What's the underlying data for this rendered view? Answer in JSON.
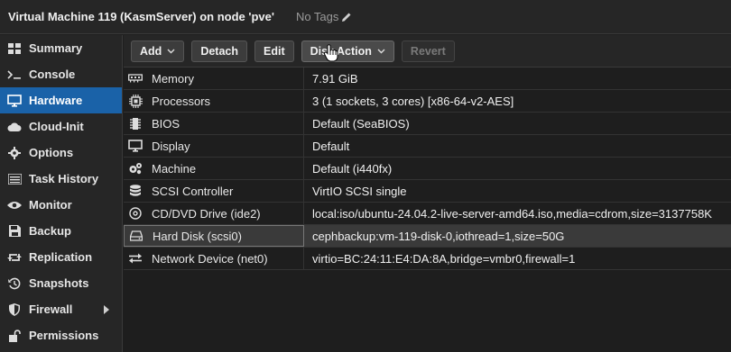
{
  "header": {
    "title": "Virtual Machine 119 (KasmServer) on node 'pve'",
    "tags_label": "No Tags"
  },
  "sidebar": {
    "items": [
      {
        "label": "Summary",
        "icon": "summary-icon"
      },
      {
        "label": "Console",
        "icon": "console-icon"
      },
      {
        "label": "Hardware",
        "icon": "monitor-icon",
        "active": true
      },
      {
        "label": "Cloud-Init",
        "icon": "cloud-icon"
      },
      {
        "label": "Options",
        "icon": "gear-icon"
      },
      {
        "label": "Task History",
        "icon": "list-icon"
      },
      {
        "label": "Monitor",
        "icon": "eye-icon"
      },
      {
        "label": "Backup",
        "icon": "floppy-icon"
      },
      {
        "label": "Replication",
        "icon": "retweet-icon"
      },
      {
        "label": "Snapshots",
        "icon": "history-icon"
      },
      {
        "label": "Firewall",
        "icon": "shield-icon"
      },
      {
        "label": "Permissions",
        "icon": "unlock-icon"
      }
    ]
  },
  "toolbar": {
    "add_label": "Add",
    "detach_label": "Detach",
    "edit_label": "Edit",
    "disk_action_label": "Disk Action",
    "revert_label": "Revert"
  },
  "hardware": [
    {
      "name": "Memory",
      "value": "7.91 GiB",
      "icon": "memory-icon"
    },
    {
      "name": "Processors",
      "value": "3 (1 sockets, 3 cores) [x86-64-v2-AES]",
      "icon": "cpu-icon"
    },
    {
      "name": "BIOS",
      "value": "Default (SeaBIOS)",
      "icon": "chip-icon"
    },
    {
      "name": "Display",
      "value": "Default",
      "icon": "desktop-icon"
    },
    {
      "name": "Machine",
      "value": "Default (i440fx)",
      "icon": "cogs-icon"
    },
    {
      "name": "SCSI Controller",
      "value": "VirtIO SCSI single",
      "icon": "database-icon"
    },
    {
      "name": "CD/DVD Drive (ide2)",
      "value": "local:iso/ubuntu-24.04.2-live-server-amd64.iso,media=cdrom,size=3137758K",
      "icon": "cdrom-icon"
    },
    {
      "name": "Hard Disk (scsi0)",
      "value": "cephbackup:vm-119-disk-0,iothread=1,size=50G",
      "icon": "hdd-icon",
      "selected": true
    },
    {
      "name": "Network Device (net0)",
      "value": "virtio=BC:24:11:E4:DA:8A,bridge=vmbr0,firewall=1",
      "icon": "exchange-icon"
    }
  ],
  "colors": {
    "accent": "#1a62a8",
    "background": "#1e1e1e",
    "panel": "#262626"
  }
}
